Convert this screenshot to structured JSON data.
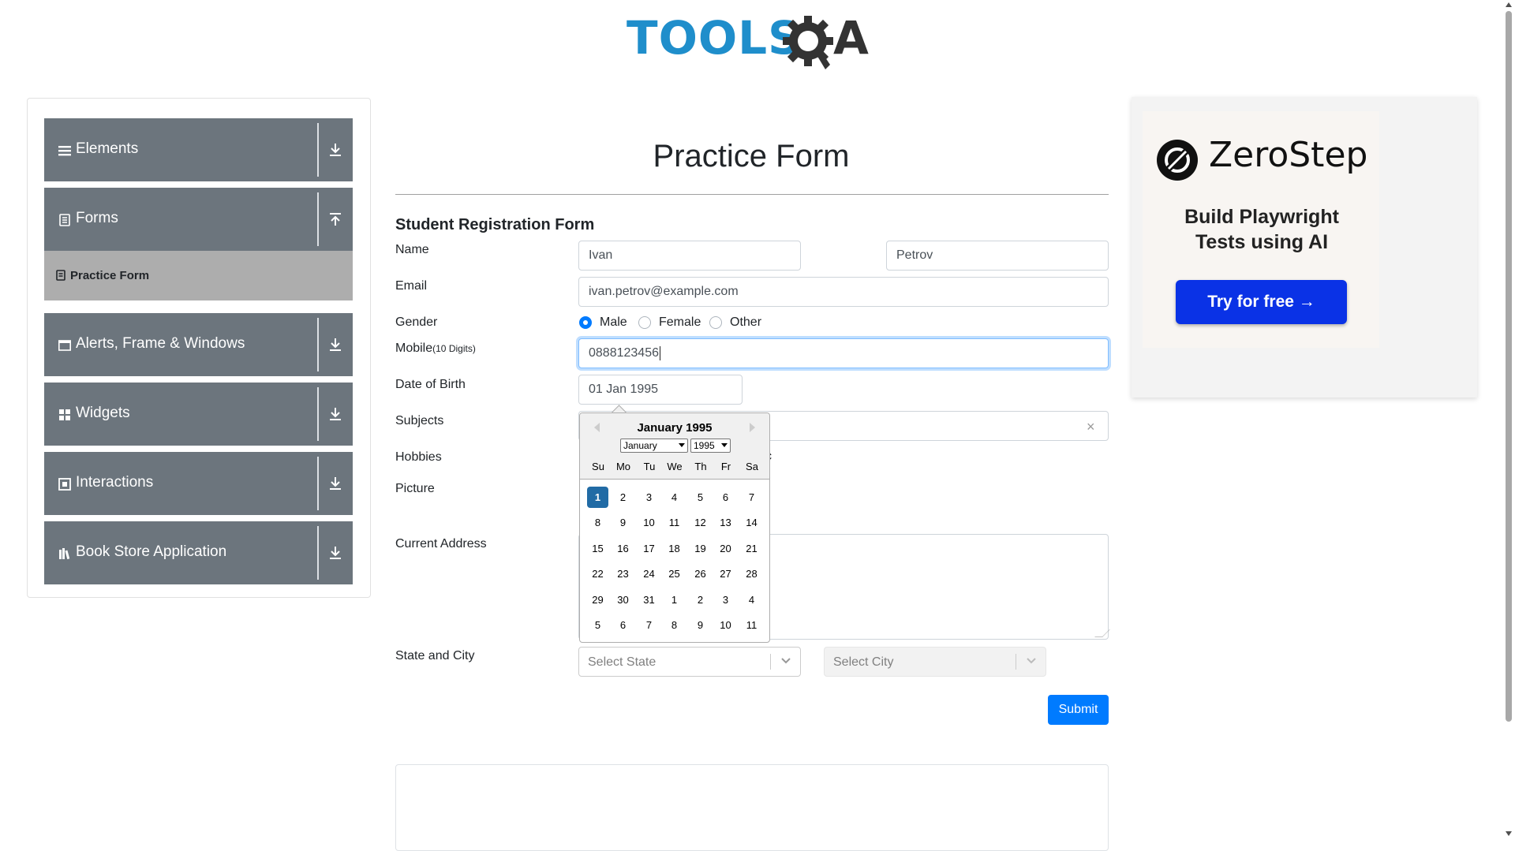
{
  "logo": {
    "text_left": "TOOLS",
    "text_right": "QA"
  },
  "sidebar": {
    "groups": [
      {
        "label": "Elements",
        "icon": "menu-icon"
      },
      {
        "label": "Forms",
        "icon": "form-icon"
      },
      {
        "label": "Alerts, Frame & Windows",
        "icon": "window-icon"
      },
      {
        "label": "Widgets",
        "icon": "widgets-icon"
      },
      {
        "label": "Interactions",
        "icon": "interactions-icon"
      },
      {
        "label": "Book Store Application",
        "icon": "bookstore-icon"
      }
    ],
    "active_item": {
      "label": "Practice Form",
      "icon": "form-item-icon"
    }
  },
  "form": {
    "page_title": "Practice Form",
    "heading": "Student Registration Form",
    "name_label": "Name",
    "first_name": "Ivan",
    "last_name": "Petrov",
    "email_label": "Email",
    "email": "ivan.petrov@example.com",
    "gender_label": "Gender",
    "gender_options": [
      "Male",
      "Female",
      "Other"
    ],
    "gender_selected": "Male",
    "mobile_label": "Mobile",
    "mobile_hint": "(10 Digits)",
    "mobile": "0888123456",
    "dob_label": "Date of Birth",
    "dob": "01 Jan 1995",
    "subjects_label": "Subjects",
    "subjects_clear": "×",
    "hobbies_label": "Hobbies",
    "hobbies_partial": "c",
    "picture_label": "Picture",
    "address_label": "Current Address",
    "state_city_label": "State and City",
    "state_placeholder": "Select State",
    "city_placeholder": "Select City",
    "submit": "Submit"
  },
  "datepicker": {
    "month_year": "January 1995",
    "month_select": "January",
    "year_select": "1995",
    "day_names": [
      "Su",
      "Mo",
      "Tu",
      "We",
      "Th",
      "Fr",
      "Sa"
    ],
    "weeks": [
      [
        "1",
        "2",
        "3",
        "4",
        "5",
        "6",
        "7"
      ],
      [
        "8",
        "9",
        "10",
        "11",
        "12",
        "13",
        "14"
      ],
      [
        "15",
        "16",
        "17",
        "18",
        "19",
        "20",
        "21"
      ],
      [
        "22",
        "23",
        "24",
        "25",
        "26",
        "27",
        "28"
      ],
      [
        "29",
        "30",
        "31",
        "1",
        "2",
        "3",
        "4"
      ],
      [
        "5",
        "6",
        "7",
        "8",
        "9",
        "10",
        "11"
      ]
    ],
    "selected_day": "1"
  },
  "ad": {
    "brand": "ZeroStep",
    "line1": "Build Playwright",
    "line2": "Tests using AI",
    "button": "Try for free →"
  },
  "colors": {
    "sidebar_group": "#6c757d",
    "sidebar_active": "#adadad",
    "primary": "#007bff",
    "datepicker_selected": "#216ba5",
    "ad_button": "#0a32e6",
    "logo_blue": "#1f8ecb"
  }
}
